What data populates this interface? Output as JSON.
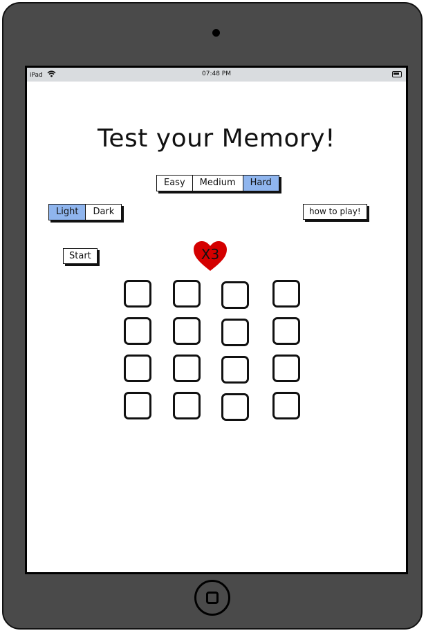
{
  "statusbar": {
    "device": "iPad",
    "time": "07:48 PM"
  },
  "app": {
    "title": "Test your Memory!"
  },
  "difficulty": {
    "options": [
      "Easy",
      "Medium",
      "Hard"
    ],
    "selected": "Hard"
  },
  "theme": {
    "options": [
      "Light",
      "Dark"
    ],
    "selected": "Light"
  },
  "help_button": "how to play!",
  "start_button": "Start",
  "lives": {
    "label": "X3",
    "count": 3,
    "color": "#d40000"
  },
  "board": {
    "rows": 4,
    "cols": 4
  },
  "colors": {
    "accent_selected": "#8fb5ee",
    "device_body": "#4a4a4a"
  }
}
